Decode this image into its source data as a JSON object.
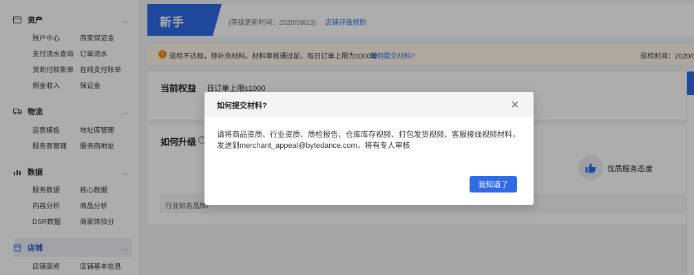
{
  "sidebar": {
    "sections": [
      {
        "icon": "wallet-icon",
        "title": "资产",
        "items": [
          "账户中心",
          "商家保证金",
          "支付流水查询",
          "订单流水",
          "货到付款账单",
          "在线支付账单",
          "佣金收入",
          "保证金"
        ]
      },
      {
        "icon": "truck-icon",
        "title": "物流",
        "items": [
          "运费模板",
          "地址库管理",
          "服务商管理",
          "服务商地址"
        ]
      },
      {
        "icon": "chart-icon",
        "title": "数据",
        "items": [
          "服务数据",
          "核心数据",
          "内容分析",
          "商品分析",
          "DSR数据",
          "商家体验分"
        ]
      },
      {
        "icon": "store-icon",
        "title": "店铺",
        "items": [
          "店铺装修",
          "店铺基本信息"
        ]
      }
    ]
  },
  "main": {
    "level": {
      "badge": "新手",
      "update_date": "(等级更新时间：2020/09/23)",
      "rule_link": "店铺评级规则"
    },
    "notice": {
      "message": "巡检不达标，待补充材料。材料审核通过前，每日订单上限为1000单",
      "link": "如何提交材料?",
      "time": "巡检时间：2020/0"
    },
    "rights": {
      "title": "当前权益",
      "value": "日订单上限≤1000"
    },
    "upgrade": {
      "title": "如何升级",
      "service_label": "优质服务态度",
      "tag_text": "行业知名品牌i"
    }
  },
  "modal": {
    "title": "如何提交材料?",
    "body": "请将商品资质、行业资质、质检报告、仓库库存视频、打包发货视频、客服接线视频材料，发送到merchant_appeal@bytedance.com，将有专人审核",
    "confirm_label": "我知道了"
  },
  "colors": {
    "primary": "#2e6ae6",
    "warning": "#f08c18",
    "notice_bg": "#fff6e8"
  }
}
